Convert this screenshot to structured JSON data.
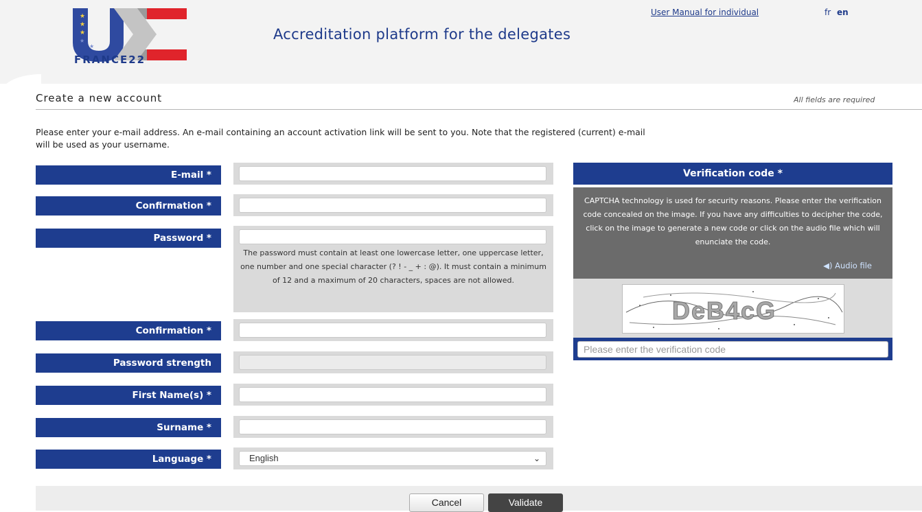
{
  "header": {
    "logo_text": "FRANCE22",
    "title": "Accreditation platform for the delegates",
    "manual_link": "User Manual for individual",
    "lang_fr": "fr",
    "lang_en": "en"
  },
  "section": {
    "title": "Create a new account",
    "required_note": "All fields are required",
    "intro_line1": "Please enter your e-mail address. An e-mail containing an account activation link will be sent to you. Note that the registered (current) e-mail",
    "intro_line2": "will be used as your username."
  },
  "form": {
    "email_label": "E-mail *",
    "email_confirm_label": "Confirmation *",
    "password_label": "Password *",
    "password_hint": "The password must contain at least one lowercase letter, one uppercase letter, one number and one special character (? ! - _ + : @). It must contain a minimum of 12 and a maximum of 20 characters, spaces are not allowed.",
    "password_confirm_label": "Confirmation *",
    "strength_label": "Password strength",
    "first_name_label": "First Name(s) *",
    "surname_label": "Surname *",
    "language_label": "Language *",
    "language_value": "English"
  },
  "verification": {
    "title": "Verification code *",
    "info": "CAPTCHA technology is used for security reasons. Please enter the verification code concealed on the image. If you have any difficulties to decipher the code, click on the image to generate a new code or click on the audio file which will enunciate the code.",
    "audio_label": "Audio file",
    "captcha_text": "DeB4cG",
    "placeholder": "Please enter the verification code"
  },
  "buttons": {
    "cancel": "Cancel",
    "validate": "Validate"
  },
  "colors": {
    "brand_blue": "#1e3d8f",
    "panel_gray": "#6b6b6b",
    "field_gray": "#dadada",
    "logo_red": "#e0242b"
  },
  "icons": [
    "eu-stars-logo",
    "speaker-icon",
    "chevron-down-icon"
  ]
}
